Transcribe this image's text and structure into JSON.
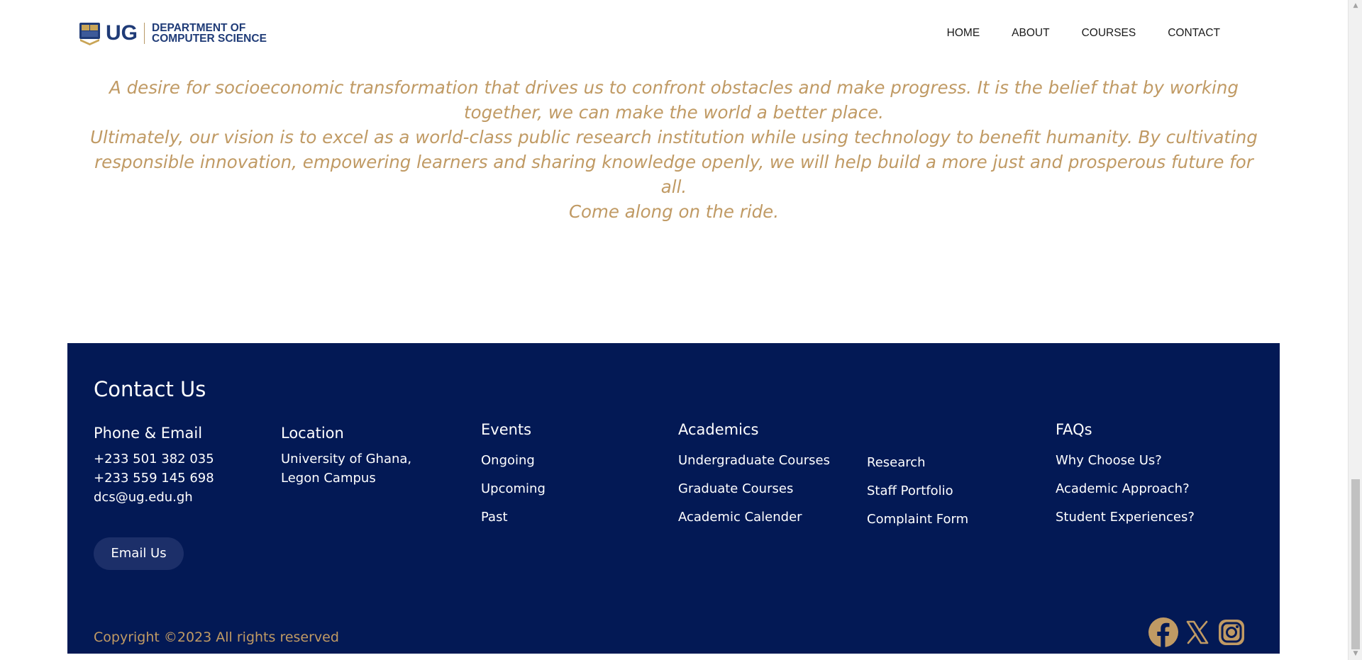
{
  "header": {
    "logo_ug": "UG",
    "logo_line1": "DEPARTMENT OF",
    "logo_line2": "COMPUTER SCIENCE",
    "nav": [
      "HOME",
      "ABOUT",
      "COURSES",
      "CONTACT"
    ]
  },
  "vision": {
    "paragraph1": "A desire for socioeconomic transformation that drives us to confront obstacles and make progress. It is the belief that by working together, we can make the world a better place.",
    "paragraph2": "Ultimately, our vision is to excel as a world-class public research institution while using technology to benefit humanity. By cultivating responsible innovation, empowering learners and sharing knowledge openly, we will help build a more just and prosperous future for all.",
    "paragraph3": "Come along on the ride."
  },
  "footer": {
    "title": "Contact Us",
    "phone_email": {
      "heading": "Phone & Email",
      "phone1": "+233 501 382 035",
      "phone2": "+233 559 145 698",
      "email": "dcs@ug.edu.gh"
    },
    "location": {
      "heading": "Location",
      "line1": "University of Ghana,",
      "line2": "Legon Campus"
    },
    "events": {
      "heading": "Events",
      "links": [
        "Ongoing",
        "Upcoming",
        "Past"
      ]
    },
    "academics": {
      "heading": "Academics",
      "links_col1": [
        "Undergraduate Courses",
        "Graduate Courses",
        "Academic Calender"
      ],
      "links_col2": [
        "Research",
        "Staff Portfolio",
        "Complaint Form"
      ]
    },
    "faqs": {
      "heading": "FAQs",
      "links": [
        "Why Choose Us?",
        "Academic Approach?",
        "Student Experiences?"
      ]
    },
    "email_button": "Email Us",
    "copyright": "Copyright ©2023 All rights reserved",
    "social_icons": [
      "facebook-icon",
      "x-icon",
      "instagram-icon"
    ]
  },
  "colors": {
    "navy": "#031955",
    "gold": "#c09a64",
    "button": "#1c2f69",
    "logo_blue": "#1f3b77"
  }
}
